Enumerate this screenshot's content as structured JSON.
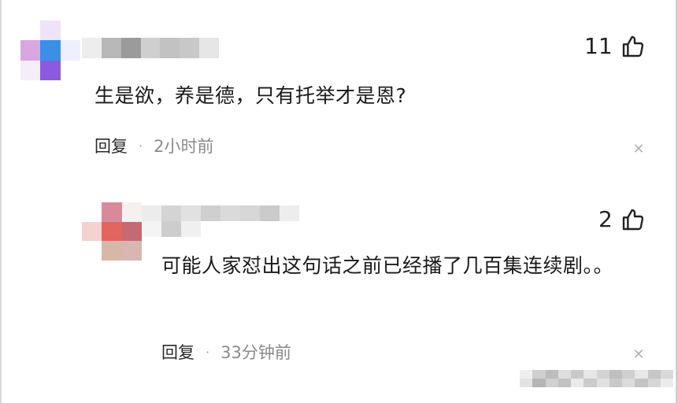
{
  "comments": [
    {
      "text": "生是欲，养是德，只有托举才是恩?",
      "likes": "11",
      "reply_label": "回复",
      "time": "2小时前"
    },
    {
      "text": "可能人家怼出这句话之前已经播了几百集连续剧。。",
      "likes": "2",
      "reply_label": "回复",
      "time": "33分钟前"
    }
  ],
  "icons": {
    "like": "thumbs-up-icon",
    "close": "close-icon",
    "separator": "·"
  },
  "colors": {
    "text": "#1a1a1a",
    "muted": "#8a8a8a",
    "close": "#b3b3b3",
    "avatar_purple": "#8a5be0",
    "avatar_red": "#e2655e"
  }
}
